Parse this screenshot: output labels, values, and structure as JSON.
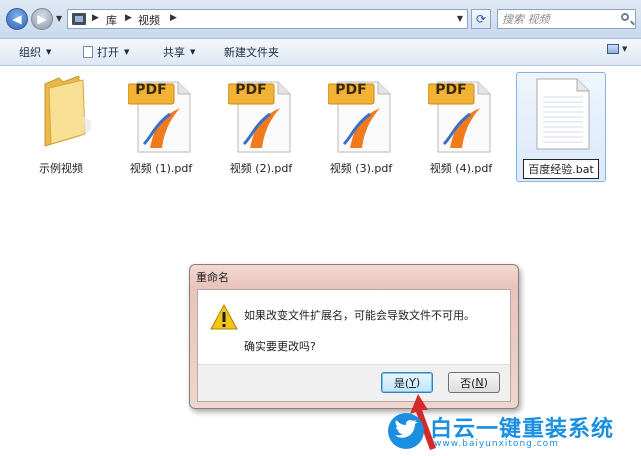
{
  "address": {
    "crumbs": [
      "库",
      "视频"
    ],
    "search_placeholder": "搜索 视频"
  },
  "toolbar": {
    "organize": "组织",
    "open": "打开",
    "share": "共享",
    "new_folder": "新建文件夹"
  },
  "files": [
    {
      "name": "示例视频",
      "icon": "folder-icon"
    },
    {
      "name": "视频 (1).pdf",
      "icon": "pdf-file-icon",
      "badge": "PDF"
    },
    {
      "name": "视频 (2).pdf",
      "icon": "pdf-file-icon",
      "badge": "PDF"
    },
    {
      "name": "视频 (3).pdf",
      "icon": "pdf-file-icon",
      "badge": "PDF"
    },
    {
      "name": "视频 (4).pdf",
      "icon": "pdf-file-icon",
      "badge": "PDF"
    },
    {
      "name": "百度经验.bat",
      "icon": "text-file-icon",
      "state": "renaming"
    }
  ],
  "dialog": {
    "title": "重命名",
    "message": "如果改变文件扩展名，可能会导致文件不可用。",
    "question": "确实要更改吗?",
    "yes": {
      "label": "是(",
      "key": "Y",
      "suffix": ")"
    },
    "no": {
      "label": "否(",
      "key": "N",
      "suffix": ")"
    }
  },
  "watermark": {
    "title": "白云一键重装系统",
    "url": "www.baiyunxitong.com"
  },
  "colors": {
    "accent": "#1b8ee0",
    "dialog_frame": "#e8c4bb",
    "pointer": "#d42a2a"
  }
}
